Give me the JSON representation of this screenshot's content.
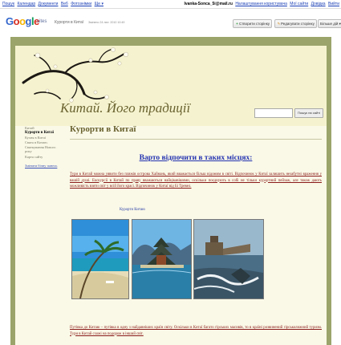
{
  "google_bar": {
    "left_links": [
      "Пошук",
      "Календар",
      "Документи",
      "Веб",
      "Фотознімки",
      "Ще ▾"
    ],
    "email": "Ivanka-Sonca_5i@mail.ru",
    "right_links": [
      "Налаштування користувача",
      "Мої сайти",
      "Довідка",
      "Вийти"
    ]
  },
  "sites_bar": {
    "logo_letters": [
      "G",
      "o",
      "o",
      "g",
      "l",
      "e"
    ],
    "sites_word": "sites",
    "site_name": "Курорти в Китаї",
    "updated": "Змінено 24 лют. 2010 10:49",
    "create_button": "Створити сторінку",
    "edit_button": "Редагувати сторінку",
    "more_button": "Більше дій ▾"
  },
  "site": {
    "title": "Китай. Його традиції",
    "search_button": "Пошук на сайті"
  },
  "nav": {
    "items": [
      "Китай",
      "Курорти в Китаї",
      "Кухня в Китаї",
      "Свята в Китаю. Святкування Нового року",
      "Карта сайту"
    ],
    "active_index": 1,
    "edit_link": "Змінити бічну панель"
  },
  "content": {
    "page_title": "Курорти в Китаї",
    "heading": "Варто відпочити в таких місцях:",
    "paragraph1": "Тури в Китай можна уявити без пляжів острова Хайнань, який вважається більш відомим в світі. Відпочинок у Китаї залишить незабутні враження у вашій душі. Екскурсії в Китай по праву вважаються найцікавішими, оскільки поєднують в собі не тільки курортний пейзаж, але також дають можливість взяти світ у всій його красі. Відпочинок у Китаї від Бі Тревел.",
    "photo_label": "Курорти Китаю",
    "paragraph2": "Путівка до Китаю – путівка в одну з найдавніших країн світу. Оскільки в Китаї багато гірських масивів, то в країні розвинений гірськолижний туризм. Тури в Китай схожі на подорож в інший світ."
  },
  "colors": {
    "frame": "#9ba46a",
    "page_bg": "#faf9e7",
    "header_bg": "#f5f3cf",
    "title_color": "#6a6230",
    "heading_color": "#2332b0",
    "text_color": "#8a1a1a"
  }
}
